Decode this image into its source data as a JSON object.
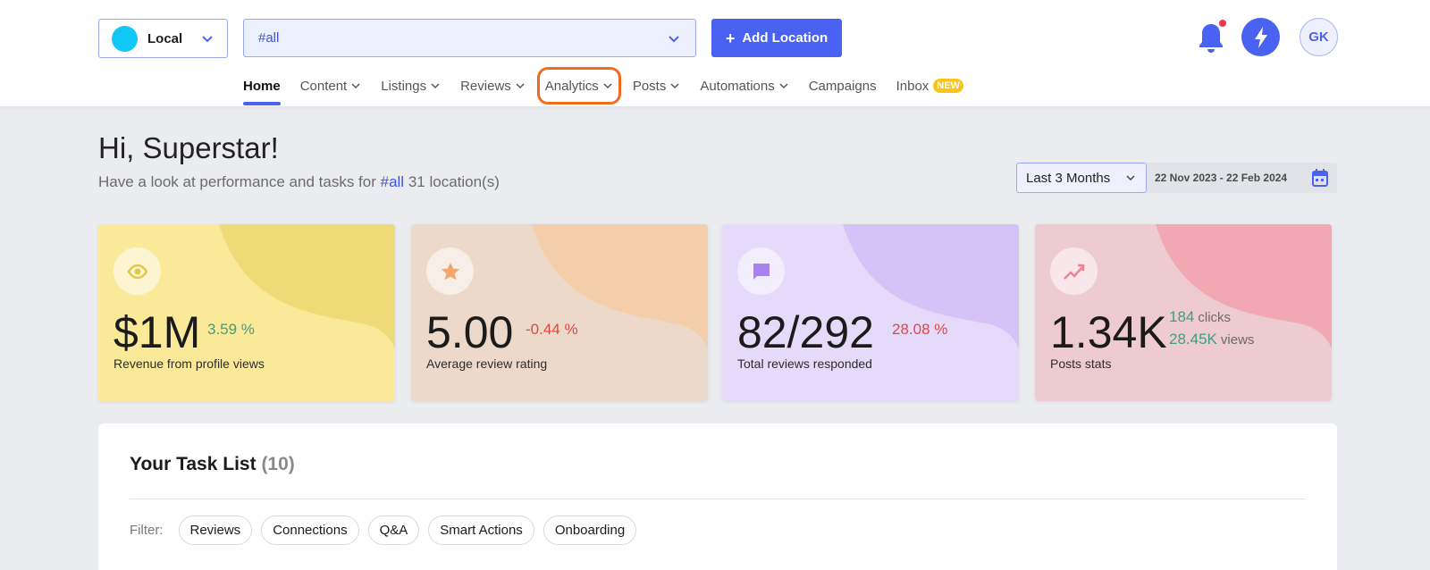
{
  "header": {
    "account": {
      "label": "Local"
    },
    "location_selector": {
      "value": "#all"
    },
    "add_location": {
      "label": "Add Location"
    },
    "avatar": {
      "initials": "GK"
    }
  },
  "nav": {
    "items": [
      {
        "label": "Home",
        "active": true
      },
      {
        "label": "Content"
      },
      {
        "label": "Listings"
      },
      {
        "label": "Reviews"
      },
      {
        "label": "Analytics",
        "highlighted": true
      },
      {
        "label": "Posts"
      },
      {
        "label": "Automations"
      },
      {
        "label": "Campaigns"
      },
      {
        "label": "Inbox",
        "badge": "NEW"
      }
    ]
  },
  "greeting": {
    "title": "Hi, Superstar!",
    "subtitle_prefix": "Have a look at performance and tasks for",
    "subtitle_tag": "#all",
    "subtitle_suffix": "31 location(s)"
  },
  "period": {
    "selected": "Last 3 Months",
    "range": "22 Nov 2023 - 22 Feb 2024"
  },
  "cards": [
    {
      "value": "$1M",
      "change": "3.59 %",
      "trend": "up",
      "caption": "Revenue from profile views",
      "icon": "eye-icon",
      "bg": "#fbe99a",
      "wave": "#eedb78",
      "icon_color": "#e8cf5a"
    },
    {
      "value": "5.00",
      "change": "-0.44 %",
      "trend": "down",
      "caption": "Average review rating",
      "icon": "star-icon",
      "bg": "#ecd9c9",
      "wave": "#f4ceaa",
      "icon_color": "#f2a66a"
    },
    {
      "value": "82/292",
      "change": "28.08 %",
      "trend": "down",
      "caption": "Total reviews responded",
      "icon": "chat-icon",
      "bg": "#e5dafa",
      "wave": "#d5c3f8",
      "icon_color": "#a882ef"
    },
    {
      "value": "1.34K",
      "clicks_value": "184",
      "clicks_unit": "clicks",
      "views_value": "28.45K",
      "views_unit": "views",
      "caption": "Posts stats",
      "icon": "trend-icon",
      "bg": "#eecbd1",
      "wave": "#f2a8b2",
      "icon_color": "#ef8292"
    }
  ],
  "tasks": {
    "title": "Your Task List",
    "count": "(10)",
    "filter_label": "Filter:",
    "filters": [
      "Reviews",
      "Connections",
      "Q&A",
      "Smart Actions",
      "Onboarding"
    ]
  }
}
